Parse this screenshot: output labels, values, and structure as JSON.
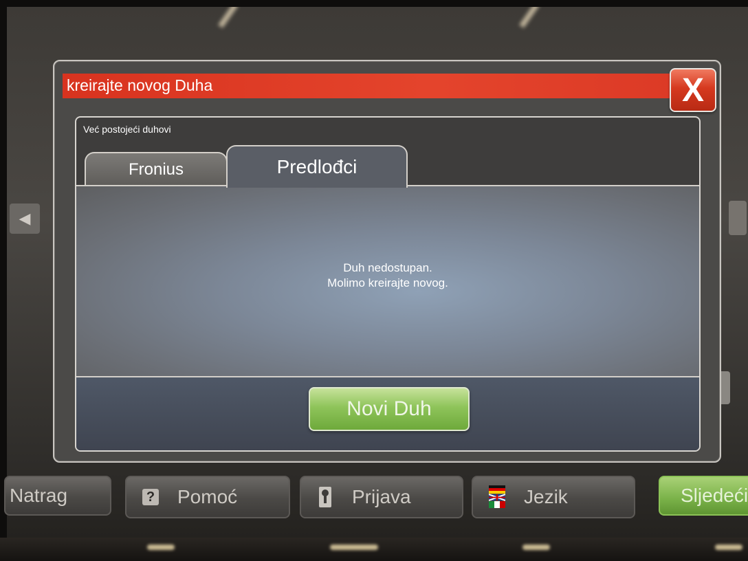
{
  "dialog": {
    "title": "kreirajte novog Duha",
    "close_label": "X",
    "section_label": "Već postojeći duhovi",
    "tabs": [
      {
        "label": "Fronius",
        "active": false
      },
      {
        "label": "Predlođci",
        "active": true
      }
    ],
    "message_line1": "Duh nedostupan.",
    "message_line2": "Molimo kreirajte novog.",
    "new_button_label": "Novi Duh"
  },
  "toolbar": {
    "back_label": "Natrag",
    "help_label": "Pomoć",
    "login_label": "Prijava",
    "language_label": "Jezik",
    "next_label": "Sljedeći"
  },
  "icons": {
    "close": "close-icon",
    "help": "help-icon",
    "login": "key-icon",
    "language": "flags-icon",
    "back_arrow": "left-arrow-icon"
  },
  "colors": {
    "title_bar": "#e4442c",
    "new_button": "#8fc45a",
    "next_button": "#79b148"
  }
}
